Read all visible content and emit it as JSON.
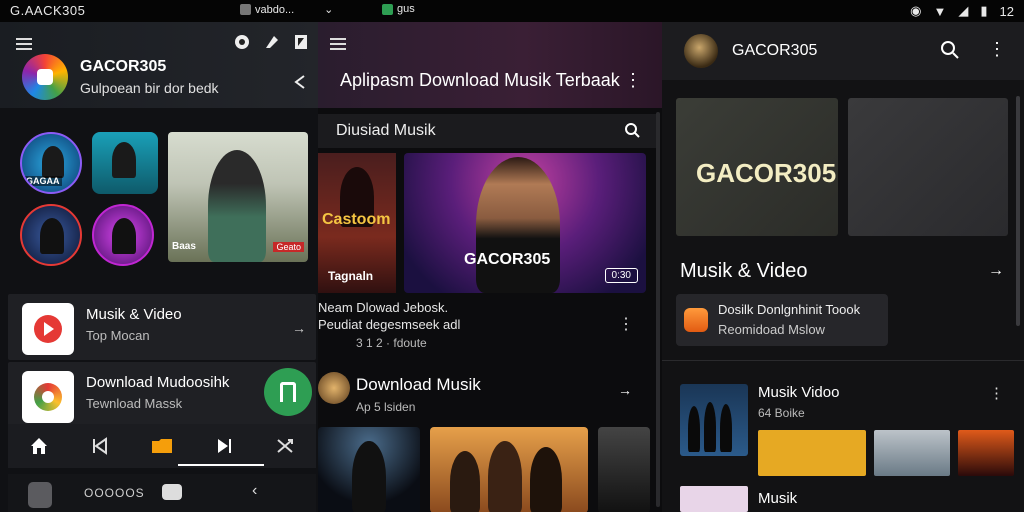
{
  "statusbar": {
    "left_text": "G.AACK305",
    "mid1_text": "vabdo...",
    "mid2_text": "gus",
    "time": "12"
  },
  "panel1": {
    "app_title": "GACOR305",
    "app_subtitle": "Gulpoean bir dor bedk",
    "thumbs": [
      {
        "label": "GAGAA"
      },
      {
        "label": ""
      },
      {
        "label": ""
      },
      {
        "label": ""
      }
    ],
    "hero_labels": [
      "Baas",
      "Geato"
    ],
    "cards": [
      {
        "title": "Musik & Video",
        "subtitle": "Top Mocan"
      },
      {
        "title": "Download Mudoosihk",
        "subtitle": "Tewnload Massk"
      }
    ],
    "bottom_text": "OOOOOS",
    "colors": {
      "accent": "#2e9e53",
      "ring": "#8b5cf6"
    }
  },
  "panel2": {
    "title": "Aplipasm Download Musik Terbaak",
    "search_text": "Diusiad Musik",
    "left_card_label": "Tagnaln",
    "left_card_big": "Castoom",
    "hero_label": "GACOR305",
    "hero_badge": "0:30",
    "desc_line1": "Neam Dlowad Jebosk.",
    "desc_line2": "Peudiat degesmseek adl",
    "desc_meta": "3 1 2 · fdoute",
    "download_title": "Download Musik",
    "download_sub": "Ap 5 lsiden"
  },
  "panel3": {
    "title": "GACOR305",
    "brand": "GACOR305",
    "section_title": "Musik & Video",
    "promo_line1": "Dosilk Donlgnhinit Toook",
    "promo_line2": "Reomidoad Mslow",
    "music_video_title": "Musik Vidoo",
    "music_video_sub": "64 Boike",
    "bottom_title": "Musik"
  }
}
